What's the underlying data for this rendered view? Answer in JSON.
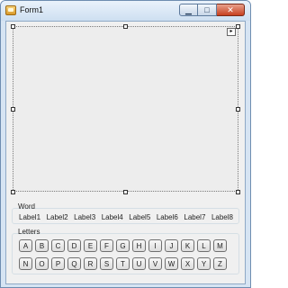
{
  "window": {
    "title": "Form1",
    "controls": {
      "minimize": "▁",
      "maximize": "□",
      "close": "✕"
    }
  },
  "designer": {
    "smart_tag": "▸"
  },
  "word_group": {
    "label": "Word",
    "labels": [
      "Label1",
      "Label2",
      "Label3",
      "Label4",
      "Label5",
      "Label6",
      "Label7",
      "Label8"
    ]
  },
  "letters_group": {
    "label": "Letters",
    "row1": [
      "A",
      "B",
      "C",
      "D",
      "E",
      "F",
      "G",
      "H",
      "I",
      "J",
      "K",
      "L",
      "M"
    ],
    "row2": [
      "N",
      "O",
      "P",
      "Q",
      "R",
      "S",
      "T",
      "U",
      "V",
      "W",
      "X",
      "Y",
      "Z"
    ]
  },
  "colors": {
    "frame_blue": "#d6e4f3",
    "client": "#f0f0f0",
    "close_red": "#c7401f"
  }
}
